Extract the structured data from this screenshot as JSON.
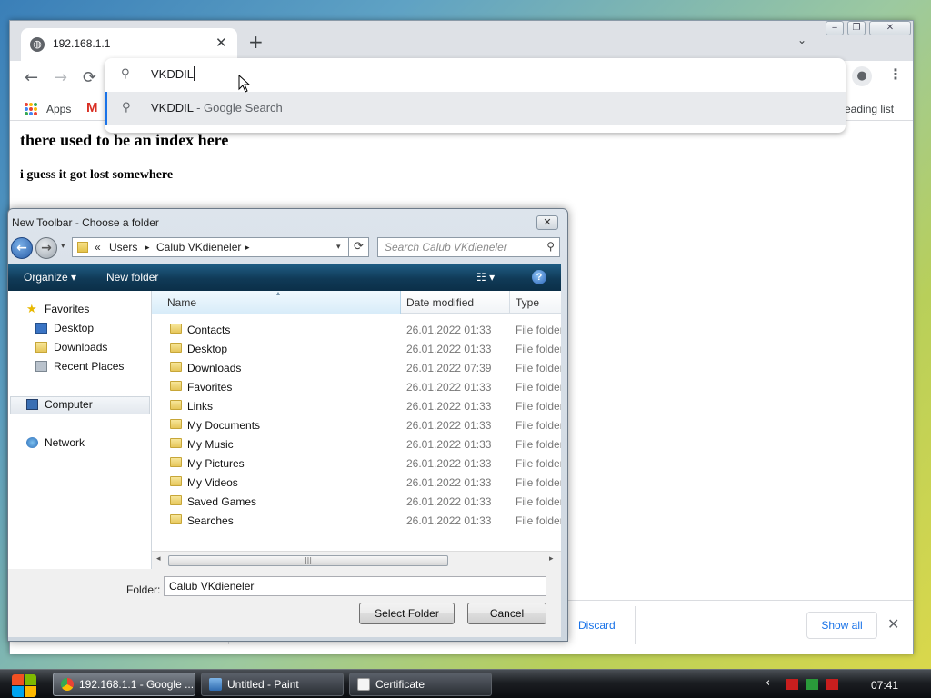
{
  "browser": {
    "tab_title": "192.168.1.1",
    "tab_close": "✕",
    "new_tab": "+",
    "tab_menu": "⌄",
    "window_controls": [
      "‒",
      "❐",
      "✕"
    ],
    "back": "←",
    "forward": "→",
    "reload": "⟳",
    "profile_icon": "person-icon",
    "menu_icon": "⋮",
    "omnibox": {
      "query": "VKDDIL",
      "suggestion_query": "VKDDIL",
      "suggestion_suffix": " - Google Search"
    },
    "bookmarks": {
      "apps_label": "Apps",
      "gmail_glyph": "M",
      "reading_list": "eading list"
    },
    "page": {
      "heading": "there used to be an index here",
      "subheading": "i guess it got lost somewhere"
    },
    "download_bar": {
      "discard": "Discard",
      "show_all": "Show all",
      "close": "✕"
    },
    "colors": {
      "accent": "#1a73e8",
      "tabstrip": "#dee1e6"
    }
  },
  "dialog": {
    "title": "New Toolbar - Choose a folder",
    "close": "✕",
    "address": {
      "history": "«",
      "crumbs": [
        "Users",
        "Calub VKdieneler"
      ],
      "sep": "▸"
    },
    "search_placeholder": "Search Calub VKdieneler",
    "toolbar": {
      "organize": "Organize ▾",
      "new_folder": "New folder",
      "views": "☷ ▾",
      "help": "?"
    },
    "nav": [
      {
        "label": "Favorites",
        "icon": "star-icon"
      },
      {
        "label": "Desktop",
        "icon": "desktop-icon"
      },
      {
        "label": "Downloads",
        "icon": "downloads-folder-icon"
      },
      {
        "label": "Recent Places",
        "icon": "recent-places-icon"
      },
      {
        "label": "Computer",
        "icon": "computer-icon"
      },
      {
        "label": "Network",
        "icon": "network-icon"
      }
    ],
    "columns": {
      "name": "Name",
      "date": "Date modified",
      "type": "Type",
      "sort_glyph": "▴"
    },
    "rows": [
      {
        "name": "Contacts",
        "date": "26.01.2022 01:33",
        "type": "File folder"
      },
      {
        "name": "Desktop",
        "date": "26.01.2022 01:33",
        "type": "File folder"
      },
      {
        "name": "Downloads",
        "date": "26.01.2022 07:39",
        "type": "File folder"
      },
      {
        "name": "Favorites",
        "date": "26.01.2022 01:33",
        "type": "File folder"
      },
      {
        "name": "Links",
        "date": "26.01.2022 01:33",
        "type": "File folder"
      },
      {
        "name": "My Documents",
        "date": "26.01.2022 01:33",
        "type": "File folder"
      },
      {
        "name": "My Music",
        "date": "26.01.2022 01:33",
        "type": "File folder"
      },
      {
        "name": "My Pictures",
        "date": "26.01.2022 01:33",
        "type": "File folder"
      },
      {
        "name": "My Videos",
        "date": "26.01.2022 01:33",
        "type": "File folder"
      },
      {
        "name": "Saved Games",
        "date": "26.01.2022 01:33",
        "type": "File folder"
      },
      {
        "name": "Searches",
        "date": "26.01.2022 01:33",
        "type": "File folder"
      }
    ],
    "folder_label": "Folder:",
    "folder_value": "Calub VKdieneler",
    "select_button": "Select Folder",
    "cancel_button": "Cancel"
  },
  "taskbar": {
    "buttons": [
      {
        "label": "192.168.1.1 - Google ...",
        "icon": "chrome-icon",
        "active": true
      },
      {
        "label": "Untitled - Paint",
        "icon": "paint-icon",
        "active": false
      },
      {
        "label": "Certificate",
        "icon": "certificate-icon",
        "active": false
      }
    ],
    "tray_chevron": "‹",
    "clock": "07:41"
  }
}
